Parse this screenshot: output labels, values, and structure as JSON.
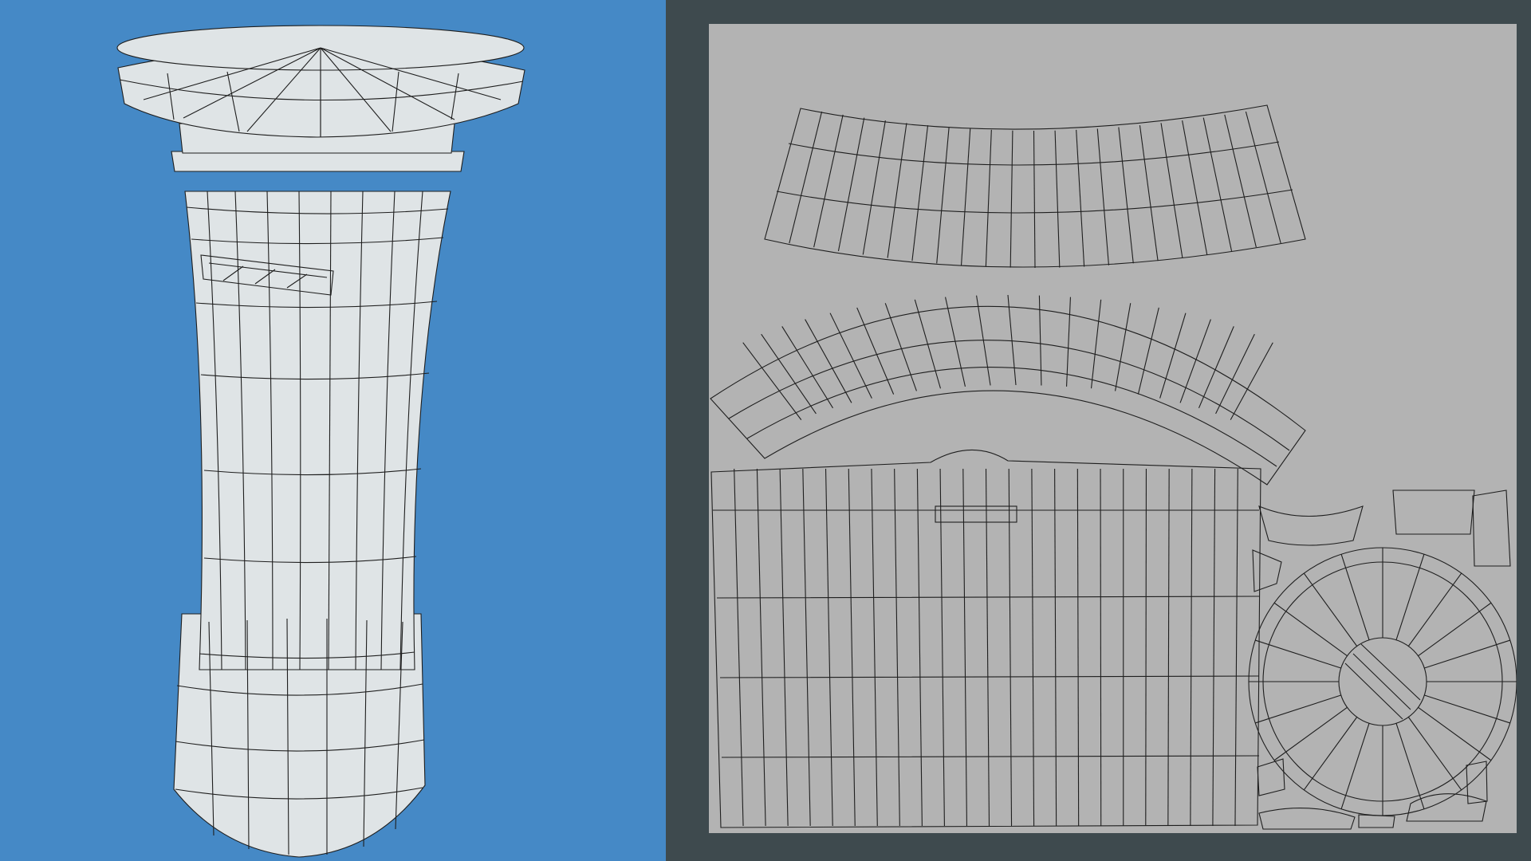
{
  "colors": {
    "viewport_background": "#4589c6",
    "uv_panel_background": "#3e4a4e",
    "uv_area_background": "#b3b3b3",
    "mesh_fill": "#dfe4e6",
    "wire": "#1e1e1e"
  }
}
